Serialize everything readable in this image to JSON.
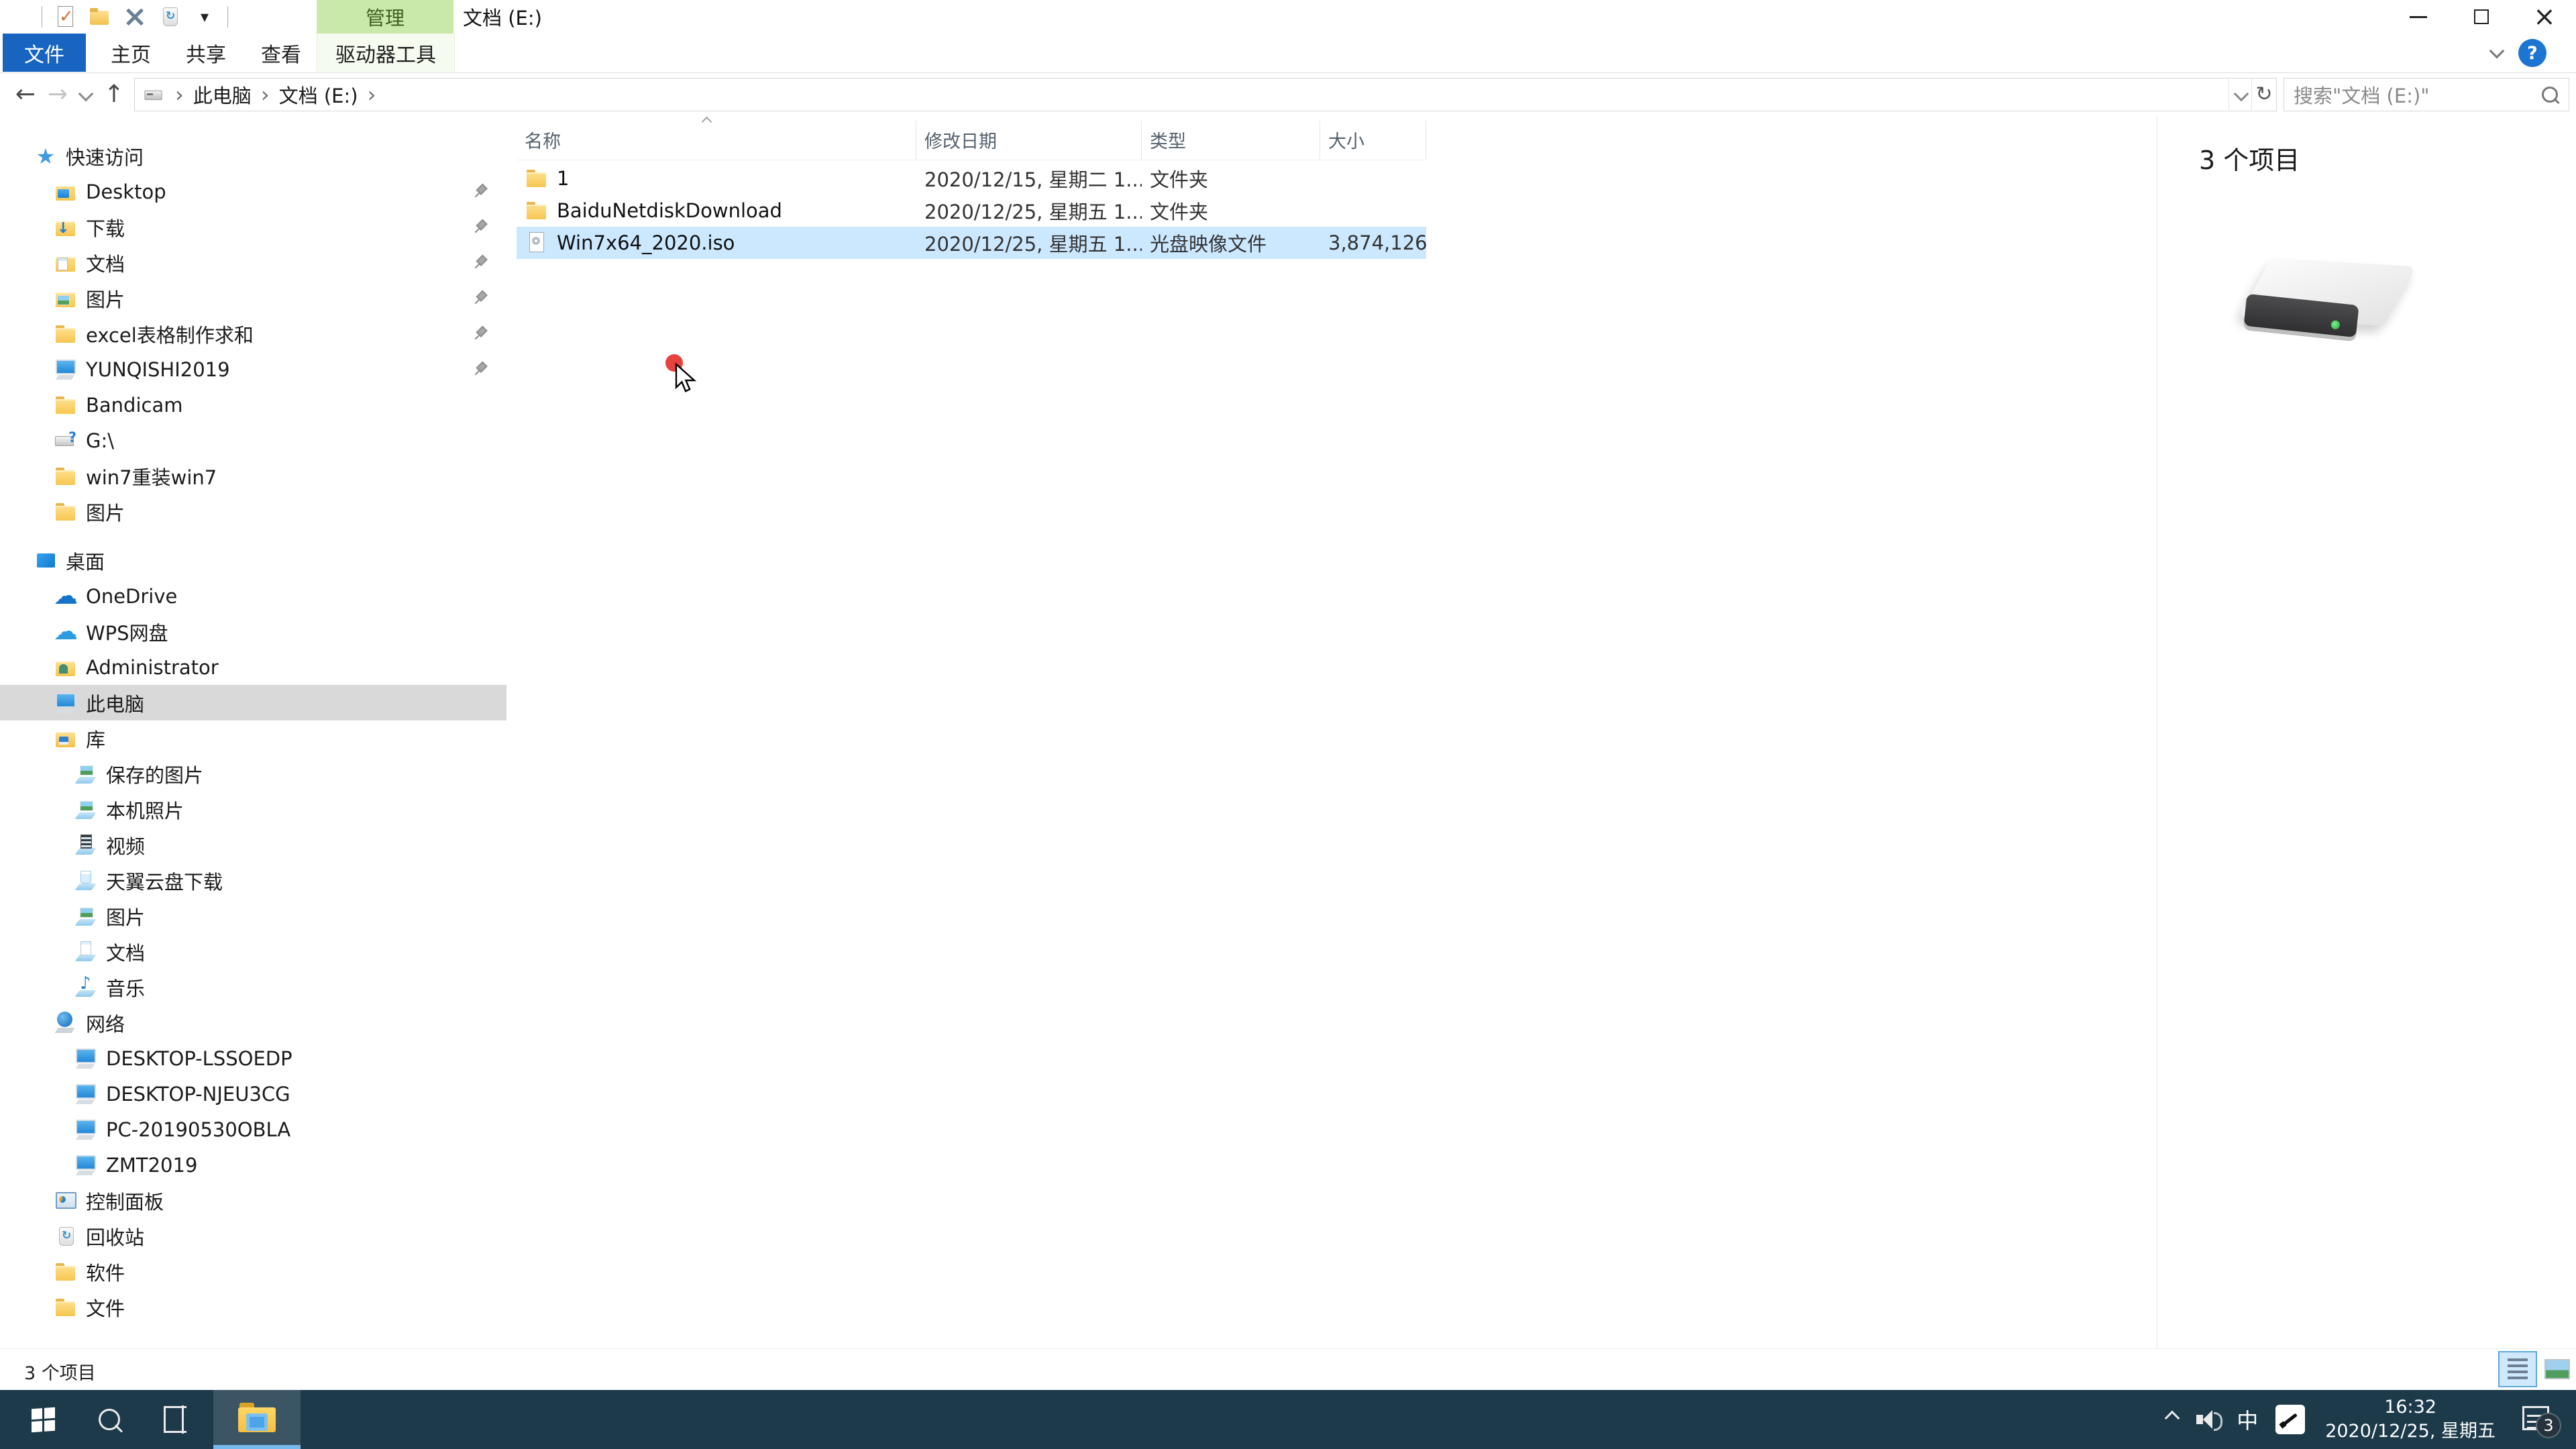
{
  "titlebar": {
    "qat_icons": [
      "drive-icon",
      "check-document-icon",
      "new-folder-icon",
      "delete-icon",
      "recycle-bin-icon",
      "qat-dropdown-icon"
    ],
    "context_header": "管理",
    "title": "文档 (E:)"
  },
  "ribbon": {
    "file_tab": "文件",
    "tabs": [
      "主页",
      "共享",
      "查看"
    ],
    "context_tab": "驱动器工具",
    "help_label": "?"
  },
  "address": {
    "breadcrumb": [
      "此电脑",
      "文档 (E:)"
    ],
    "search_placeholder": "搜索\"文档 (E:)\""
  },
  "sidebar": {
    "items": [
      {
        "label": "快速访问",
        "icon": "star",
        "depth": 0
      },
      {
        "label": "Desktop",
        "icon": "folder folder-desktop",
        "depth": 1,
        "pinned": true
      },
      {
        "label": "下载",
        "icon": "folder folder-download",
        "depth": 1,
        "pinned": true
      },
      {
        "label": "文档",
        "icon": "folder folder-doc",
        "depth": 1,
        "pinned": true
      },
      {
        "label": "图片",
        "icon": "folder folder-pic",
        "depth": 1,
        "pinned": true
      },
      {
        "label": "excel表格制作求和",
        "icon": "folder",
        "depth": 1,
        "pinned": true
      },
      {
        "label": "YUNQISHI2019",
        "icon": "computer",
        "depth": 1,
        "pinned": true
      },
      {
        "label": "Bandicam",
        "icon": "folder",
        "depth": 1
      },
      {
        "label": "G:\\",
        "icon": "usb",
        "depth": 1
      },
      {
        "label": "win7重装win7",
        "icon": "folder",
        "depth": 1
      },
      {
        "label": "图片",
        "icon": "folder",
        "depth": 1
      },
      {
        "label": "桌面",
        "icon": "desktop",
        "depth": 0,
        "gap_before": true
      },
      {
        "label": "OneDrive",
        "icon": "cloud",
        "depth": 1
      },
      {
        "label": "WPS网盘",
        "icon": "cloud-wps",
        "depth": 1
      },
      {
        "label": "Administrator",
        "icon": "folder folder-user",
        "depth": 1
      },
      {
        "label": "此电脑",
        "icon": "computer",
        "depth": 1,
        "selected": true
      },
      {
        "label": "库",
        "icon": "library",
        "depth": 1
      },
      {
        "label": "保存的图片",
        "icon": "media-pic",
        "depth": 2
      },
      {
        "label": "本机照片",
        "icon": "media-pic",
        "depth": 2
      },
      {
        "label": "视频",
        "icon": "media-video",
        "depth": 2
      },
      {
        "label": "天翼云盘下载",
        "icon": "media-cloud",
        "depth": 2
      },
      {
        "label": "图片",
        "icon": "media-pic",
        "depth": 2
      },
      {
        "label": "文档",
        "icon": "media-doc",
        "depth": 2
      },
      {
        "label": "音乐",
        "icon": "media-music",
        "depth": 2
      },
      {
        "label": "网络",
        "icon": "network",
        "depth": 1
      },
      {
        "label": "DESKTOP-LSSOEDP",
        "icon": "pc",
        "depth": 2
      },
      {
        "label": "DESKTOP-NJEU3CG",
        "icon": "pc",
        "depth": 2
      },
      {
        "label": "PC-20190530OBLA",
        "icon": "pc",
        "depth": 2
      },
      {
        "label": "ZMT2019",
        "icon": "pc",
        "depth": 2
      },
      {
        "label": "控制面板",
        "icon": "control-panel",
        "depth": 1
      },
      {
        "label": "回收站",
        "icon": "recycle-bin",
        "depth": 1
      },
      {
        "label": "软件",
        "icon": "folder",
        "depth": 1
      },
      {
        "label": "文件",
        "icon": "folder",
        "depth": 1
      }
    ]
  },
  "files": {
    "columns": [
      "名称",
      "修改日期",
      "类型",
      "大小"
    ],
    "rows": [
      {
        "icon": "folder",
        "name": "1",
        "date": "2020/12/15, 星期二 1...",
        "type": "文件夹",
        "size": ""
      },
      {
        "icon": "folder",
        "name": "BaiduNetdiskDownload",
        "date": "2020/12/25, 星期五 1...",
        "type": "文件夹",
        "size": ""
      },
      {
        "icon": "iso-file",
        "name": "Win7x64_2020.iso",
        "date": "2020/12/25, 星期五 1...",
        "type": "光盘映像文件",
        "size": "3,874,126...",
        "selected": true
      }
    ]
  },
  "preview": {
    "item_count": "3 个项目"
  },
  "statusbar": {
    "item_count": "3 个项目",
    "view_icons": [
      "details-view-icon",
      "large-icons-view-icon"
    ]
  },
  "taskbar": {
    "tray_icons": [
      "hidden-icons-chevron",
      "volume-icon",
      "ime-indicator",
      "pen-check-icon",
      "action-center-icon"
    ],
    "ime": "中",
    "time": "16:32",
    "date": "2020/12/25, 星期五",
    "notification_count": "3"
  }
}
